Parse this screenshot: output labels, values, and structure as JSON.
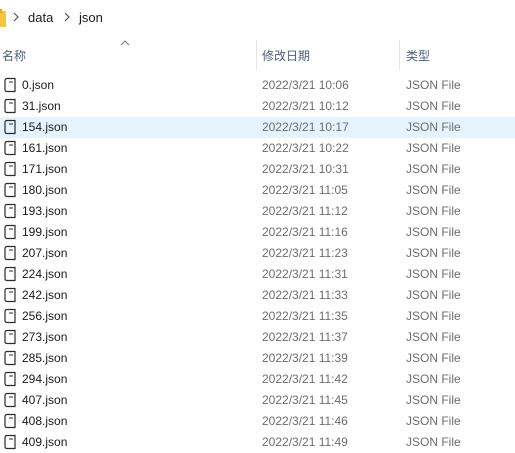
{
  "breadcrumb": {
    "items": [
      "data",
      "json"
    ]
  },
  "columns": {
    "name": "名称",
    "date": "修改日期",
    "type": "类型"
  },
  "colors": {
    "selected_row": "#e5f3ff",
    "header_text": "#4c607a",
    "secondary_text": "#6d6d6d"
  },
  "files": [
    {
      "name": "0.json",
      "date": "2022/3/21 10:06",
      "type": "JSON File",
      "selected": false
    },
    {
      "name": "31.json",
      "date": "2022/3/21 10:12",
      "type": "JSON File",
      "selected": false
    },
    {
      "name": "154.json",
      "date": "2022/3/21 10:17",
      "type": "JSON File",
      "selected": true
    },
    {
      "name": "161.json",
      "date": "2022/3/21 10:22",
      "type": "JSON File",
      "selected": false
    },
    {
      "name": "171.json",
      "date": "2022/3/21 10:31",
      "type": "JSON File",
      "selected": false
    },
    {
      "name": "180.json",
      "date": "2022/3/21 11:05",
      "type": "JSON File",
      "selected": false
    },
    {
      "name": "193.json",
      "date": "2022/3/21 11:12",
      "type": "JSON File",
      "selected": false
    },
    {
      "name": "199.json",
      "date": "2022/3/21 11:16",
      "type": "JSON File",
      "selected": false
    },
    {
      "name": "207.json",
      "date": "2022/3/21 11:23",
      "type": "JSON File",
      "selected": false
    },
    {
      "name": "224.json",
      "date": "2022/3/21 11:31",
      "type": "JSON File",
      "selected": false
    },
    {
      "name": "242.json",
      "date": "2022/3/21 11:33",
      "type": "JSON File",
      "selected": false
    },
    {
      "name": "256.json",
      "date": "2022/3/21 11:35",
      "type": "JSON File",
      "selected": false
    },
    {
      "name": "273.json",
      "date": "2022/3/21 11:37",
      "type": "JSON File",
      "selected": false
    },
    {
      "name": "285.json",
      "date": "2022/3/21 11:39",
      "type": "JSON File",
      "selected": false
    },
    {
      "name": "294.json",
      "date": "2022/3/21 11:42",
      "type": "JSON File",
      "selected": false
    },
    {
      "name": "407.json",
      "date": "2022/3/21 11:45",
      "type": "JSON File",
      "selected": false
    },
    {
      "name": "408.json",
      "date": "2022/3/21 11:46",
      "type": "JSON File",
      "selected": false
    },
    {
      "name": "409.json",
      "date": "2022/3/21 11:49",
      "type": "JSON File",
      "selected": false
    }
  ]
}
